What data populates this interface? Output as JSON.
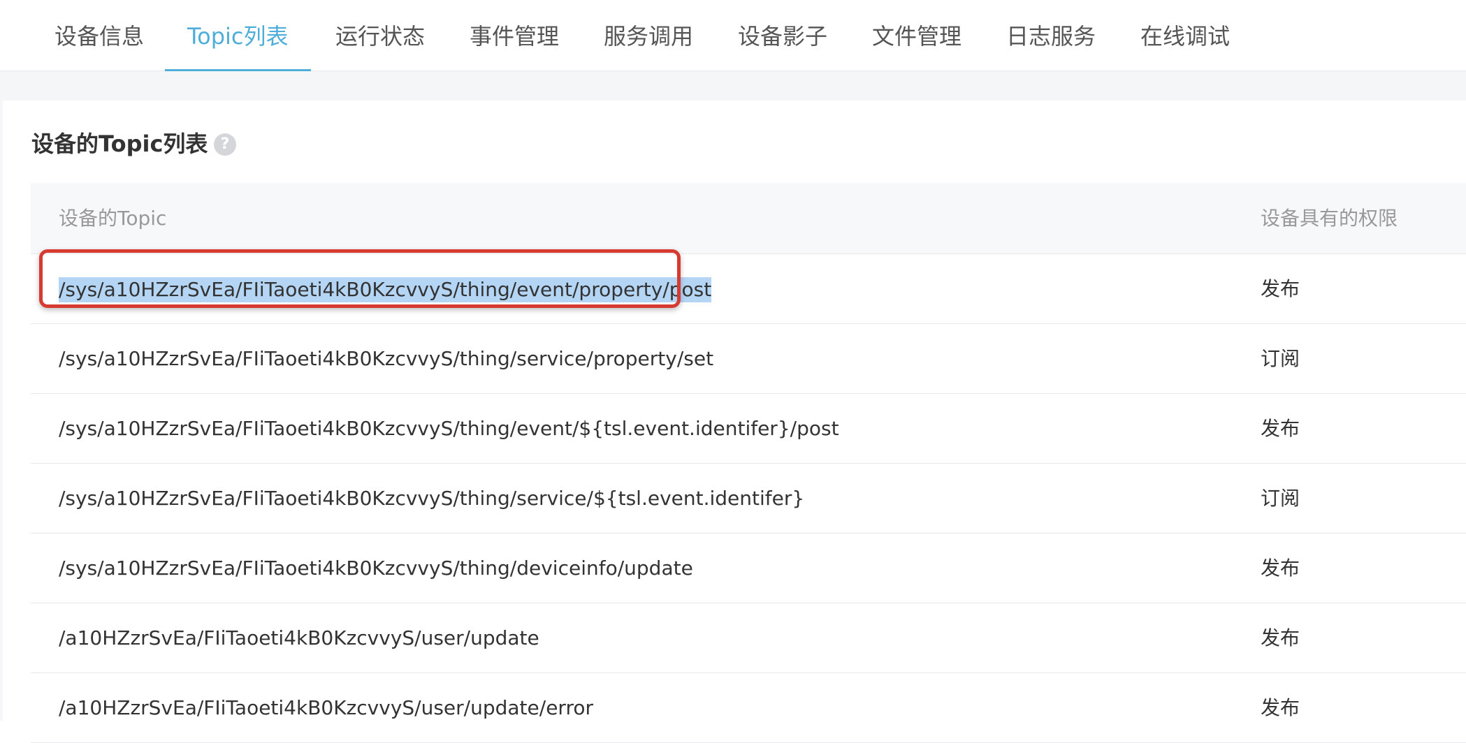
{
  "tabs": [
    {
      "label": "设备信息",
      "active": false
    },
    {
      "label": "Topic列表",
      "active": true
    },
    {
      "label": "运行状态",
      "active": false
    },
    {
      "label": "事件管理",
      "active": false
    },
    {
      "label": "服务调用",
      "active": false
    },
    {
      "label": "设备影子",
      "active": false
    },
    {
      "label": "文件管理",
      "active": false
    },
    {
      "label": "日志服务",
      "active": false
    },
    {
      "label": "在线调试",
      "active": false
    }
  ],
  "section": {
    "title": "设备的Topic列表",
    "help_icon": "question-circle-icon",
    "help_glyph": "?"
  },
  "table": {
    "headers": {
      "topic": "设备的Topic",
      "permission": "设备具有的权限"
    },
    "rows": [
      {
        "topic": "/sys/a10HZzrSvEa/FIiTaoeti4kB0KzcvvyS/thing/event/property/post",
        "permission": "发布",
        "selected": true
      },
      {
        "topic": "/sys/a10HZzrSvEa/FIiTaoeti4kB0KzcvvyS/thing/service/property/set",
        "permission": "订阅"
      },
      {
        "topic": "/sys/a10HZzrSvEa/FIiTaoeti4kB0KzcvvyS/thing/event/${tsl.event.identifer}/post",
        "permission": "发布"
      },
      {
        "topic": "/sys/a10HZzrSvEa/FIiTaoeti4kB0KzcvvyS/thing/service/${tsl.event.identifer}",
        "permission": "订阅"
      },
      {
        "topic": "/sys/a10HZzrSvEa/FIiTaoeti4kB0KzcvvyS/thing/deviceinfo/update",
        "permission": "发布"
      },
      {
        "topic": "/a10HZzrSvEa/FIiTaoeti4kB0KzcvvyS/user/update",
        "permission": "发布"
      },
      {
        "topic": "/a10HZzrSvEa/FIiTaoeti4kB0KzcvvyS/user/update/error",
        "permission": "发布"
      }
    ]
  },
  "colors": {
    "accent": "#4eaed9",
    "highlight_border": "#d63a30",
    "selection": "#b5d5f5"
  }
}
